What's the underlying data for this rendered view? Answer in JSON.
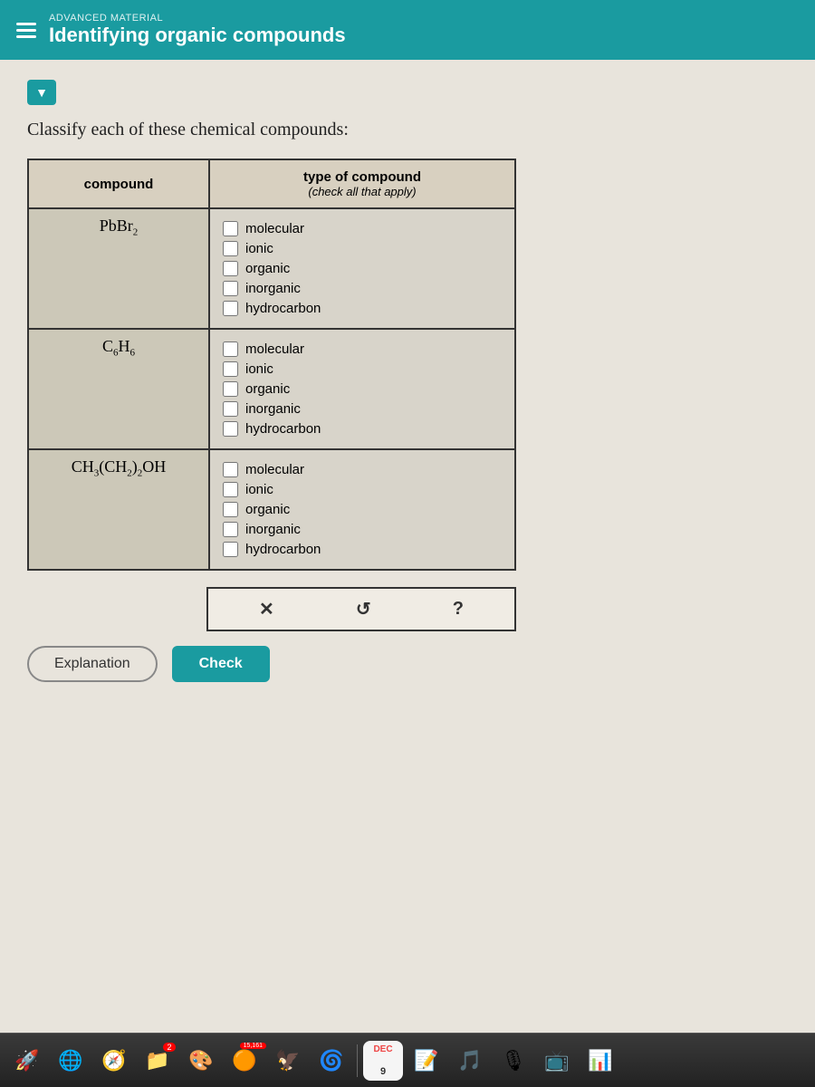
{
  "header": {
    "subtitle": "ADVANCED MATERIAL",
    "title": "Identifying organic compounds"
  },
  "page": {
    "instruction": "Classify each of these chemical compounds:",
    "collapse_button": "▼"
  },
  "table": {
    "col_compound": "compound",
    "col_type_bold": "type of compound",
    "col_type_italic": "(check all that apply)",
    "rows": [
      {
        "compound_html": "PbBr₂",
        "options": [
          "molecular",
          "ionic",
          "organic",
          "inorganic",
          "hydrocarbon"
        ],
        "checked": [
          true,
          false,
          false,
          false,
          false
        ]
      },
      {
        "compound_html": "C₆H₆",
        "options": [
          "molecular",
          "ionic",
          "organic",
          "inorganic",
          "hydrocarbon"
        ],
        "checked": [
          false,
          false,
          false,
          false,
          false
        ]
      },
      {
        "compound_html": "CH₃(CH₂)₂OH",
        "options": [
          "molecular",
          "ionic",
          "organic",
          "inorganic",
          "hydrocarbon"
        ],
        "checked": [
          false,
          false,
          false,
          false,
          false
        ]
      }
    ]
  },
  "action_buttons": {
    "clear_label": "×",
    "undo_label": "↺",
    "help_label": "?"
  },
  "bottom_buttons": {
    "explanation_label": "Explanation",
    "check_label": "Check"
  },
  "dock": {
    "items": [
      {
        "icon": "🚀",
        "name": "launchpad"
      },
      {
        "icon": "🌐",
        "name": "chrome",
        "badge": ""
      },
      {
        "icon": "🧭",
        "name": "safari"
      },
      {
        "icon": "🖥",
        "name": "finder-icon",
        "badge": "2"
      },
      {
        "icon": "🌀",
        "name": "app4"
      },
      {
        "icon": "🔵",
        "name": "app5"
      },
      {
        "icon": "📷",
        "name": "app6"
      },
      {
        "icon": "🟠",
        "name": "app7",
        "badge": "15,161"
      },
      {
        "icon": "🎵",
        "name": "music"
      },
      {
        "icon": "📅",
        "name": "calendar",
        "label": "9"
      },
      {
        "icon": "📝",
        "name": "notes"
      },
      {
        "icon": "🎙",
        "name": "podcast"
      },
      {
        "icon": "📺",
        "name": "tv"
      },
      {
        "icon": "📊",
        "name": "stats"
      }
    ]
  }
}
